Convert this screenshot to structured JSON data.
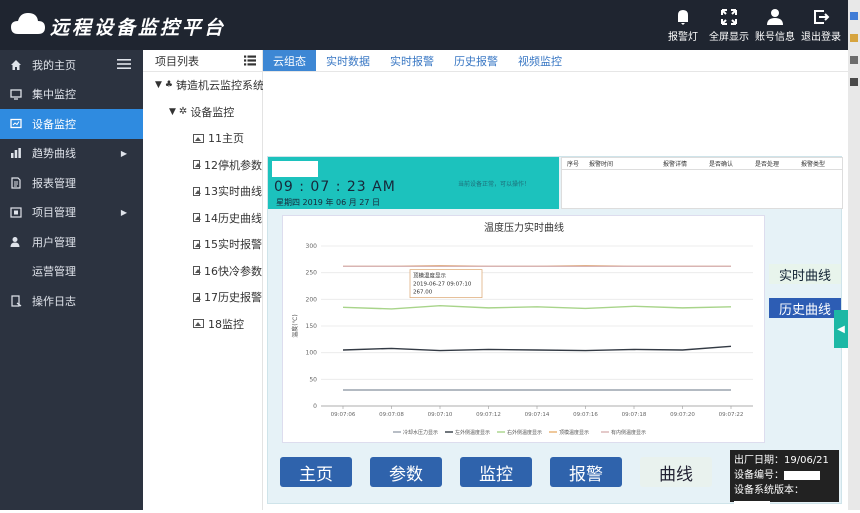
{
  "app": {
    "title": "远程设备监控平台"
  },
  "top_actions": [
    {
      "label": "报警灯",
      "icon": "bell-icon"
    },
    {
      "label": "全屏显示",
      "icon": "fullscreen-icon"
    },
    {
      "label": "账号信息",
      "icon": "user-icon"
    },
    {
      "label": "退出登录",
      "icon": "logout-icon"
    }
  ],
  "sidebar": {
    "items": [
      {
        "label": "我的主页",
        "icon": "home-icon"
      },
      {
        "label": "集中监控",
        "icon": "monitor-icon"
      },
      {
        "label": "设备监控",
        "icon": "device-monitor-icon",
        "active": true
      },
      {
        "label": "趋势曲线",
        "icon": "bar-chart-icon",
        "submenu": true
      },
      {
        "label": "报表管理",
        "icon": "report-icon"
      },
      {
        "label": "项目管理",
        "icon": "project-icon",
        "submenu": true
      },
      {
        "label": "用户管理",
        "icon": "user-manage-icon"
      },
      {
        "label": "运营管理",
        "icon": ""
      },
      {
        "label": "操作日志",
        "icon": "log-icon"
      }
    ]
  },
  "tree": {
    "header": "项目列表",
    "root": "铸造机云监控系统",
    "group": "设备监控",
    "pages": [
      "11主页",
      "12停机参数",
      "13实时曲线",
      "14历史曲线",
      "15实时报警",
      "16快冷参数",
      "17历史报警",
      "18监控"
    ]
  },
  "tabs": [
    "云组态",
    "实时数据",
    "实时报警",
    "历史报警",
    "视频监控"
  ],
  "clock": {
    "time": "09 : 07 : 23 AM",
    "date": "星期四  2019 年 06 月 27 日",
    "note": "当前设备正常，可以操作！"
  },
  "alarm_table": {
    "columns": [
      "序号",
      "报警时间",
      "报警详情",
      "是否确认",
      "是否处理",
      "报警类型"
    ]
  },
  "side_buttons": {
    "live": "实时曲线",
    "history": "历史曲线"
  },
  "nav_buttons": [
    "主页",
    "参数",
    "监控",
    "报警",
    "曲线"
  ],
  "info": {
    "factory_date": "出厂日期：19/06/21",
    "device_no": "设备编号：",
    "version": "设备系统版本："
  },
  "chart_data": {
    "type": "line",
    "title": "温度压力实时曲线",
    "ylabel": "温度(℃)",
    "ylim": [
      0,
      300
    ],
    "yticks": [
      0,
      50,
      100,
      150,
      200,
      250,
      300
    ],
    "x": [
      "09:07:06",
      "09:07:08",
      "09:07:10",
      "09:07:12",
      "09:07:14",
      "09:07:16",
      "09:07:18",
      "09:07:20",
      "09:07:22"
    ],
    "series": [
      {
        "name": "冷却水压力显示",
        "color": "#9aa3ad",
        "values": [
          30,
          30,
          30,
          30,
          30,
          30,
          30,
          30,
          30
        ]
      },
      {
        "name": "左外侧温度显示",
        "color": "#333a44",
        "values": [
          105,
          108,
          104,
          106,
          105,
          104,
          106,
          105,
          112
        ]
      },
      {
        "name": "右外侧温度显示",
        "color": "#a8d48a",
        "values": [
          185,
          182,
          188,
          184,
          186,
          183,
          187,
          184,
          186
        ]
      },
      {
        "name": "顶模温度显示",
        "color": "#e8b070",
        "values": [
          262,
          262,
          263,
          262,
          262,
          263,
          262,
          262,
          262
        ]
      },
      {
        "name": "有内侧温度显示",
        "color": "#d8b4b4",
        "values": [
          262,
          262,
          262,
          262,
          262,
          262,
          262,
          262,
          262
        ]
      }
    ],
    "tooltip": {
      "title": "顶模温度显示",
      "time": "2019-06-27 09:07:10",
      "value": "267.00"
    },
    "grid": true,
    "legend": "bottom"
  }
}
